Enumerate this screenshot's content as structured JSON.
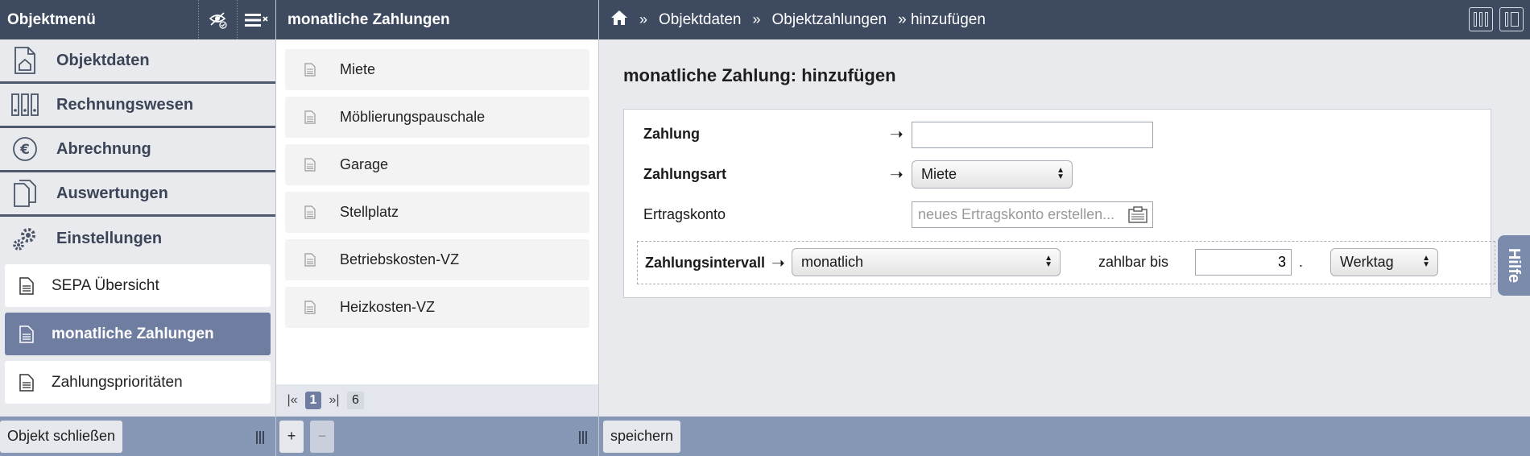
{
  "header": {
    "left_title": "Objektmenü",
    "mid_title": "monatliche Zahlungen",
    "breadcrumb": [
      "Objektdaten",
      "Objektzahlungen",
      "» hinzufügen"
    ],
    "breadcrumb_sep": "»"
  },
  "sidebar": {
    "menu": [
      {
        "label": "Objektdaten",
        "icon": "house-document-icon"
      },
      {
        "label": "Rechnungswesen",
        "icon": "binders-icon"
      },
      {
        "label": "Abrechnung",
        "icon": "euro-icon"
      },
      {
        "label": "Auswertungen",
        "icon": "documents-icon"
      },
      {
        "label": "Einstellungen",
        "icon": "gears-icon"
      }
    ],
    "sub_items": [
      {
        "label": "SEPA Übersicht",
        "active": false
      },
      {
        "label": "monatliche Zahlungen",
        "active": true
      },
      {
        "label": "Zahlungsprioritäten",
        "active": false
      }
    ]
  },
  "list": {
    "items": [
      "Miete",
      "Möblierungspauschale",
      "Garage",
      "Stellplatz",
      "Betriebskosten-VZ",
      "Heizkosten-VZ"
    ],
    "pager": {
      "first": "|«",
      "current": "1",
      "last": "»|",
      "total": "6"
    }
  },
  "form": {
    "title": "monatliche Zahlung: hinzufügen",
    "zahlung_label": "Zahlung",
    "zahlung_value": "",
    "zahlungsart_label": "Zahlungsart",
    "zahlungsart_value": "Miete",
    "ertragskonto_label": "Ertragskonto",
    "ertragskonto_placeholder": "neues Ertragskonto erstellen...",
    "intervall_label": "Zahlungsintervall",
    "intervall_value": "monatlich",
    "zahlbar_label": "zahlbar bis",
    "zahlbar_value": "3",
    "dot": ".",
    "werktag_value": "Werktag",
    "arrow": "➝"
  },
  "help_tab": "Hilfe",
  "footer": {
    "close_object": "Objekt schließen",
    "add": "+",
    "remove": "−",
    "save": "speichern"
  },
  "colors": {
    "topbar": "#3d4a5f",
    "bottombar": "#8696b5",
    "active_item": "#6f7ea0"
  }
}
